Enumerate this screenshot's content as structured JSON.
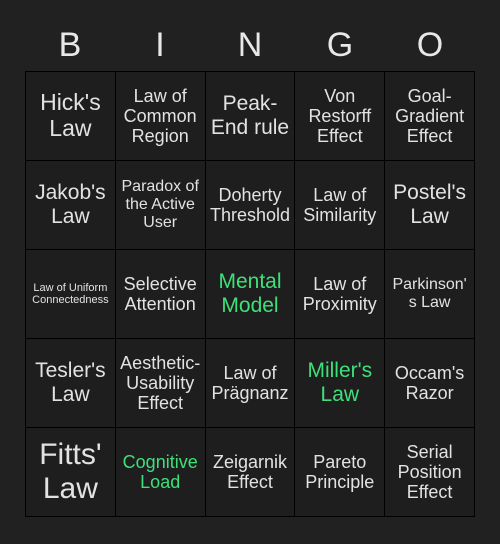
{
  "card": {
    "title_letters": [
      "B",
      "I",
      "N",
      "G",
      "O"
    ],
    "marked_color": "#3ee07a",
    "text_color": "#e2e2e2",
    "background_color": "#212121",
    "cell_background_color": "#1e1e1e",
    "grid_line_color": "#000000",
    "rows": 5,
    "columns": 5,
    "cells": [
      {
        "label": "Hick's Law",
        "marked": false,
        "size": "xl"
      },
      {
        "label": "Law of Common Region",
        "marked": false,
        "size": "md"
      },
      {
        "label": "Peak-End rule",
        "marked": false,
        "size": "lg"
      },
      {
        "label": "Von Restorff Effect",
        "marked": false,
        "size": "md"
      },
      {
        "label": "Goal-Gradient Effect",
        "marked": false,
        "size": "md"
      },
      {
        "label": "Jakob's Law",
        "marked": false,
        "size": "lg"
      },
      {
        "label": "Paradox of the Active User",
        "marked": false,
        "size": "sm"
      },
      {
        "label": "Doherty Threshold",
        "marked": false,
        "size": "md"
      },
      {
        "label": "Law of Similarity",
        "marked": false,
        "size": "md"
      },
      {
        "label": "Postel's Law",
        "marked": false,
        "size": "lg"
      },
      {
        "label": "Law of Uniform Connectedness",
        "marked": false,
        "size": "xs"
      },
      {
        "label": "Selective Attention",
        "marked": false,
        "size": "md"
      },
      {
        "label": "Mental Model",
        "marked": true,
        "size": "lg"
      },
      {
        "label": "Law of Proximity",
        "marked": false,
        "size": "md"
      },
      {
        "label": "Parkinson's Law",
        "marked": false,
        "size": "sm"
      },
      {
        "label": "Tesler's Law",
        "marked": false,
        "size": "lg"
      },
      {
        "label": "Aesthetic-Usability Effect",
        "marked": false,
        "size": "md"
      },
      {
        "label": "Law of Prägnanz",
        "marked": false,
        "size": "md"
      },
      {
        "label": "Miller's Law",
        "marked": true,
        "size": "lg"
      },
      {
        "label": "Occam's Razor",
        "marked": false,
        "size": "md"
      },
      {
        "label": "Fitts' Law",
        "marked": false,
        "size": "xxl"
      },
      {
        "label": "Cognitive Load",
        "marked": true,
        "size": "md"
      },
      {
        "label": "Zeigarnik Effect",
        "marked": false,
        "size": "md"
      },
      {
        "label": "Pareto Principle",
        "marked": false,
        "size": "md"
      },
      {
        "label": "Serial Position Effect",
        "marked": false,
        "size": "md"
      }
    ]
  }
}
